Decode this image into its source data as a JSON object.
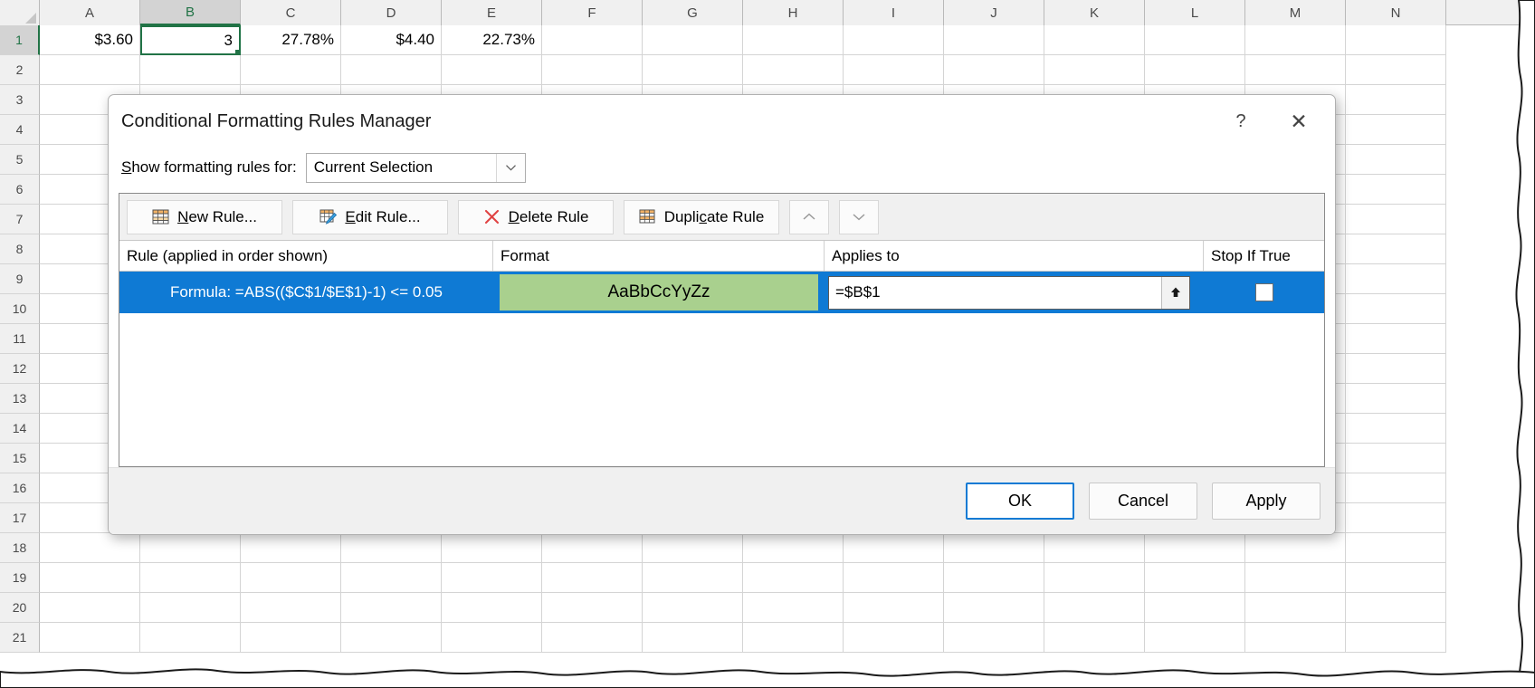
{
  "spreadsheet": {
    "columns": [
      "A",
      "B",
      "C",
      "D",
      "E",
      "F",
      "G",
      "H",
      "I",
      "J",
      "K",
      "L",
      "M",
      "N"
    ],
    "selected_column": "B",
    "rows": [
      "1",
      "2",
      "3",
      "4",
      "5",
      "6",
      "7",
      "8",
      "9",
      "10",
      "11",
      "12",
      "13",
      "14",
      "15",
      "16",
      "17",
      "18",
      "19",
      "20",
      "21"
    ],
    "selected_row": "1",
    "active_cell": "B1",
    "row1_values": [
      "$3.60",
      "3",
      "27.78%",
      "$4.40",
      "22.73%",
      "",
      "",
      "",
      "",
      "",
      "",
      "",
      "",
      ""
    ]
  },
  "dialog": {
    "title": "Conditional Formatting Rules Manager",
    "help_label": "?",
    "close_label": "✕",
    "show_rules_label": "Show formatting rules for:",
    "show_rules_label_prefix": "S",
    "show_rules_label_rest": "how formatting rules for:",
    "scope_dropdown": {
      "value": "Current Selection",
      "arrow": "⌄"
    },
    "toolbar": {
      "new_rule": "New Rule...",
      "new_rule_accel": "N",
      "new_rule_rest": "ew Rule...",
      "edit_rule": "Edit Rule...",
      "edit_rule_accel": "E",
      "edit_rule_rest": "dit Rule...",
      "delete_rule": "Delete Rule",
      "delete_rule_accel": "D",
      "delete_rule_rest": "elete Rule",
      "duplicate_rule": "Duplicate Rule",
      "duplicate_rule_pre": "Dupli",
      "duplicate_rule_accel": "c",
      "duplicate_rule_rest": "ate Rule",
      "move_up": "⌃",
      "move_down": "⌄"
    },
    "list_headers": {
      "rule": "Rule (applied in order shown)",
      "format": "Format",
      "applies_to": "Applies to",
      "stop_if_true": "Stop If True"
    },
    "rules": [
      {
        "rule": "Formula: =ABS(($C$1/$E$1)-1) <= 0.05",
        "format_preview_text": "AaBbCcYyZz",
        "format_fill_color": "#a9d08e",
        "format_font_color": "#000000",
        "applies_to": "=$B$1",
        "stop_if_true": false,
        "selected": true
      }
    ],
    "footer": {
      "ok": "OK",
      "cancel": "Cancel",
      "apply": "Apply"
    }
  },
  "colors": {
    "selection_blue": "#0f7ad4",
    "excel_green": "#217346",
    "format_green": "#a9d08e",
    "delete_red": "#e04343"
  }
}
